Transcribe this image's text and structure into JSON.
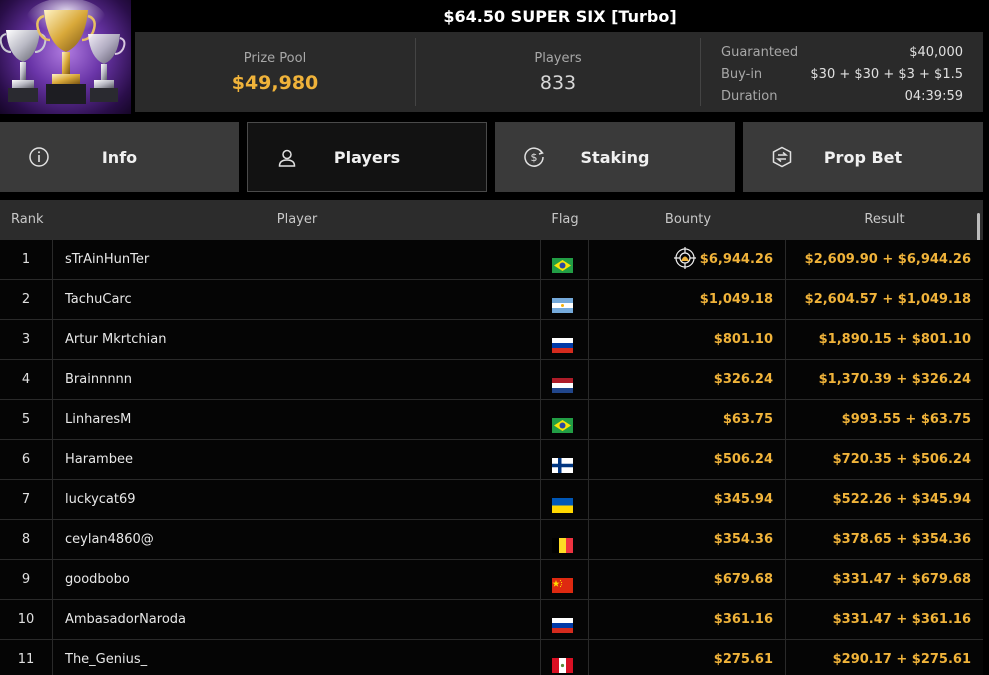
{
  "header": {
    "title": "$64.50 SUPER SIX [Turbo]",
    "prize_pool_label": "Prize Pool",
    "prize_pool": "$49,980",
    "players_label": "Players",
    "players": "833",
    "guaranteed_label": "Guaranteed",
    "guaranteed": "$40,000",
    "buyin_label": "Buy-in",
    "buyin": "$30 + $30 + $3 + $1.5",
    "duration_label": "Duration",
    "duration": "04:39:59"
  },
  "tabs": [
    {
      "label": "Info",
      "icon": "info-icon",
      "active": false
    },
    {
      "label": "Players",
      "icon": "user-icon",
      "active": true
    },
    {
      "label": "Staking",
      "icon": "dollar-coin-icon",
      "active": false
    },
    {
      "label": "Prop Bet",
      "icon": "prop-bet-icon",
      "active": false
    }
  ],
  "table": {
    "headers": {
      "rank": "Rank",
      "player": "Player",
      "flag": "Flag",
      "bounty": "Bounty",
      "result": "Result"
    },
    "rows": [
      {
        "rank": "1",
        "player": "sTrAinHunTer",
        "flag": "brazil",
        "bounty": "$6,944.26",
        "result": "$2,609.90 + $6,944.26",
        "bounty_icon": true
      },
      {
        "rank": "2",
        "player": "TachuCarc",
        "flag": "argentina",
        "bounty": "$1,049.18",
        "result": "$2,604.57 + $1,049.18"
      },
      {
        "rank": "3",
        "player": "Artur Mkrtchian",
        "flag": "russia",
        "bounty": "$801.10",
        "result": "$1,890.15 + $801.10"
      },
      {
        "rank": "4",
        "player": "Brainnnnn",
        "flag": "netherlands",
        "bounty": "$326.24",
        "result": "$1,370.39 + $326.24"
      },
      {
        "rank": "5",
        "player": "LinharesM",
        "flag": "brazil",
        "bounty": "$63.75",
        "result": "$993.55 + $63.75"
      },
      {
        "rank": "6",
        "player": "Harambee",
        "flag": "finland",
        "bounty": "$506.24",
        "result": "$720.35 + $506.24"
      },
      {
        "rank": "7",
        "player": "luckycat69",
        "flag": "ukraine",
        "bounty": "$345.94",
        "result": "$522.26 + $345.94"
      },
      {
        "rank": "8",
        "player": "ceylan4860@",
        "flag": "belgium",
        "bounty": "$354.36",
        "result": "$378.65 + $354.36"
      },
      {
        "rank": "9",
        "player": "goodbobo",
        "flag": "china",
        "bounty": "$679.68",
        "result": "$331.47 + $679.68"
      },
      {
        "rank": "10",
        "player": "AmbasadorNaroda",
        "flag": "russia",
        "bounty": "$361.16",
        "result": "$331.47 + $361.16"
      },
      {
        "rank": "11",
        "player": "The_Genius_",
        "flag": "peru",
        "bounty": "$275.61",
        "result": "$290.17 + $275.61"
      }
    ]
  },
  "colors": {
    "gold": "#f0b33a",
    "panel": "#2a2a2a",
    "tab": "#3a3a3a",
    "active_tab": "#121212"
  }
}
